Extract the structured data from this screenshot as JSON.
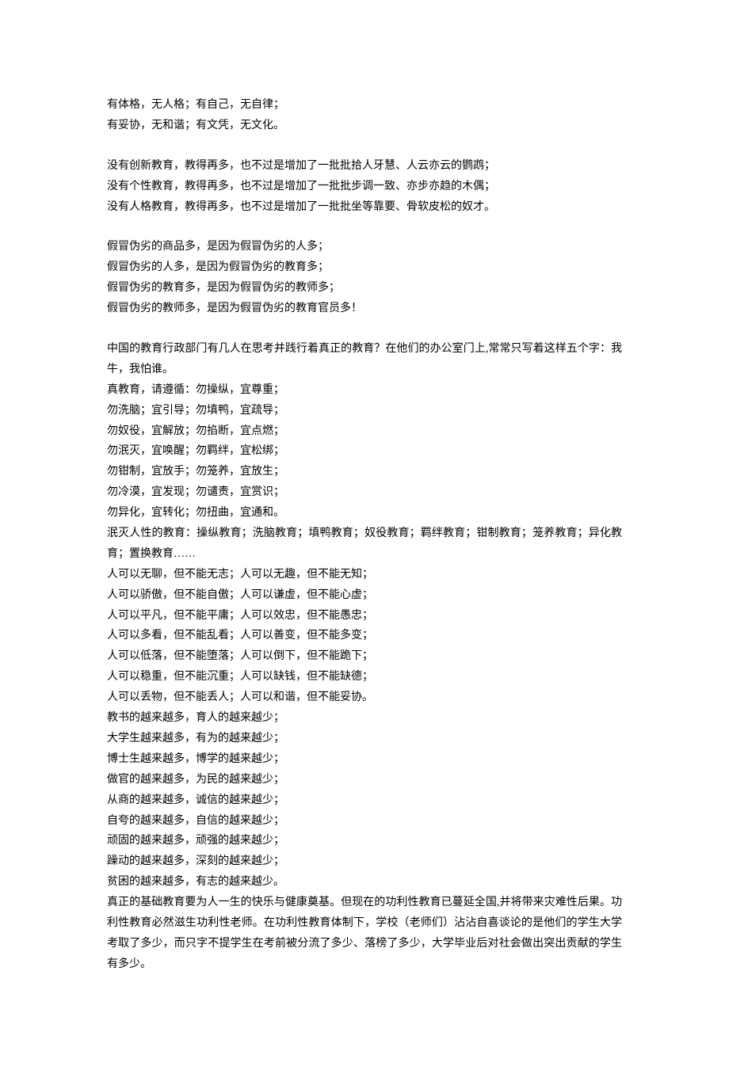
{
  "sections": [
    {
      "lines": [
        "有体格，无人格；有自己，无自律；",
        "有妥协，无和谐；有文凭，无文化。"
      ]
    },
    {
      "lines": [
        "没有创新教育，教得再多，也不过是增加了一批批拾人牙慧、人云亦云的鹦鹉；",
        "没有个性教育，教得再多，也不过是增加了一批批步调一致、亦步亦趋的木偶；",
        "没有人格教育，教得再多，也不过是增加了一批批坐等靠要、骨软皮松的奴才。"
      ]
    },
    {
      "lines": [
        "假冒伪劣的商品多，是因为假冒伪劣的人多；",
        "假冒伪劣的人多，是因为假冒伪劣的教育多；",
        "假冒伪劣的教育多，是因为假冒伪劣的教师多；",
        "假冒伪劣的教师多，是因为假冒伪劣的教育官员多！"
      ]
    },
    {
      "lines": [
        "中国的教育行政部门有几人在思考并践行着真正的教育？在他们的办公室门上,常常只写着这样五个字：我牛，我怕谁。",
        "真教育，请遵循：勿操纵，宜尊重；",
        "勿洗脑；宜引导；勿填鸭，宜疏导；",
        "勿奴役，宜解放；勿掐断，宜点燃；",
        "勿泯灭，宜唤醒；勿羁绊，宜松绑；",
        "勿钳制，宜放手；勿笼养，宜放生；",
        "勿冷漠，宜发现；勿谴责，宜赏识；",
        "勿异化，宜转化；勿扭曲，宜通和。",
        "泯灭人性的教育：操纵教育；洗脑教育；填鸭教育；奴役教育；羁绊教育；钳制教育；笼养教育；异化教育；置换教育……",
        "人可以无聊，但不能无志；人可以无趣，但不能无知；",
        "人可以骄傲，但不能自傲；人可以谦虚，但不能心虚；",
        "人可以平凡，但不能平庸；人可以效忠，但不能愚忠；",
        "人可以多看，但不能乱看；人可以善变，但不能多变；",
        "人可以低落，但不能堕落；人可以倒下，但不能跪下；",
        "人可以稳重，但不能沉重；人可以缺钱，但不能缺德；",
        "人可以丢物，但不能丢人；人可以和谐，但不能妥协。",
        "教书的越来越多，育人的越来越少；",
        "大学生越来越多，有为的越来越少；",
        "博士生越来越多，博学的越来越少；",
        "做官的越来越多，为民的越来越少；",
        "从商的越来越多，诚信的越来越少；",
        "自夸的越来越多，自信的越来越少；",
        "顽固的越来越多，顽强的越来越少；",
        "躁动的越来越多，深刻的越来越少；",
        "贫困的越来越多，有志的越来越少。",
        "真正的基础教育要为人一生的快乐与健康奠基。但现在的功利性教育已蔓延全国,并将带来灾难性后果。功利性教育必然滋生功利性老师。在功利性教育体制下，学校（老师们）沾沾自喜谈论的是他们的学生大学考取了多少，而只字不提学生在考前被分流了多少、落榜了多少，大学毕业后对社会做出突出贡献的学生有多少。"
      ]
    }
  ]
}
